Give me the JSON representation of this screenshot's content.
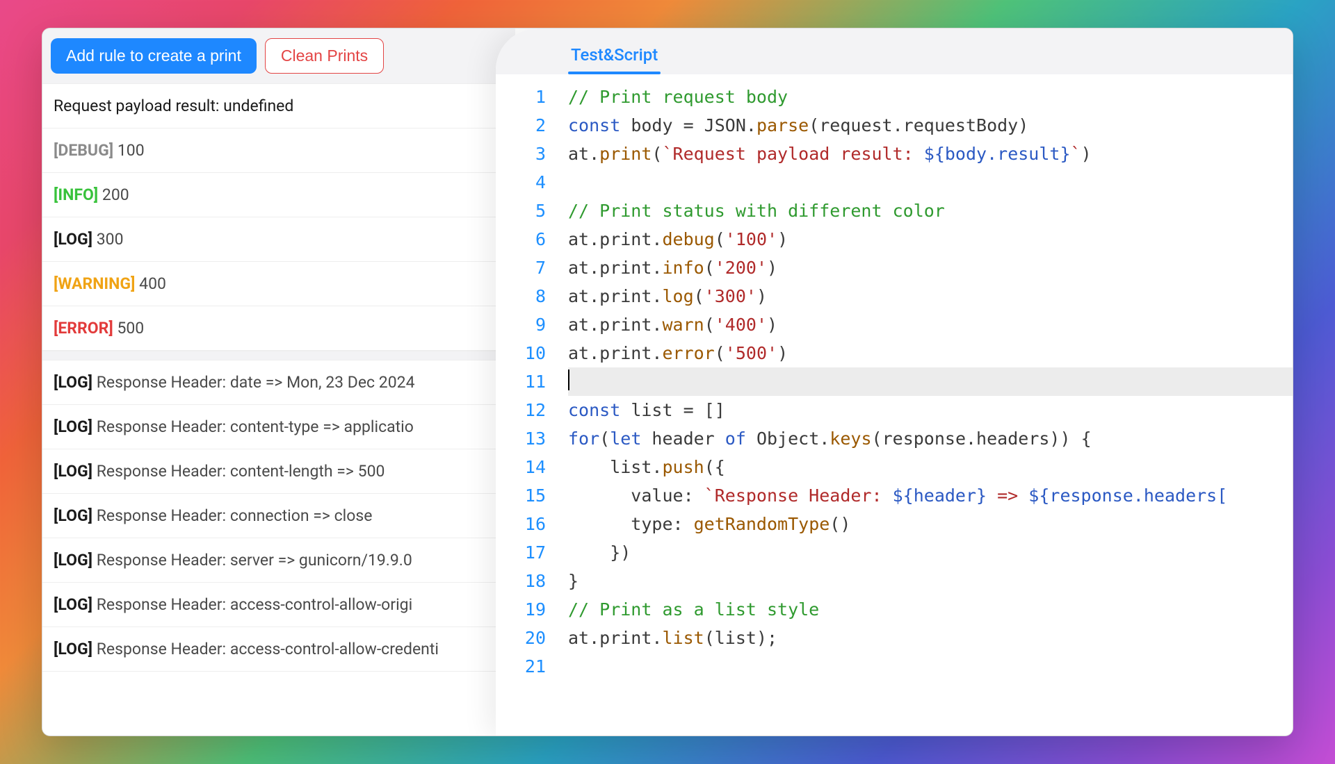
{
  "toolbar": {
    "add_rule_label": "Add rule to create a print",
    "clean_label": "Clean Prints"
  },
  "logs_top": [
    {
      "tag": null,
      "tagClass": "",
      "msg": "Request payload result: undefined"
    },
    {
      "tag": "[DEBUG]",
      "tagClass": "tag-debug",
      "msg": "100"
    },
    {
      "tag": "[INFO]",
      "tagClass": "tag-info",
      "msg": "200"
    },
    {
      "tag": "[LOG]",
      "tagClass": "tag-log",
      "msg": "300"
    },
    {
      "tag": "[WARNING]",
      "tagClass": "tag-warn",
      "msg": "400"
    },
    {
      "tag": "[ERROR]",
      "tagClass": "tag-error",
      "msg": "500"
    }
  ],
  "logs_bottom": [
    {
      "tag": "[LOG]",
      "tagClass": "tag-log",
      "msg": "Response Header: date => Mon, 23 Dec 2024"
    },
    {
      "tag": "[LOG]",
      "tagClass": "tag-log",
      "msg": "Response Header: content-type => applicatio"
    },
    {
      "tag": "[LOG]",
      "tagClass": "tag-log",
      "msg": "Response Header: content-length => 500"
    },
    {
      "tag": "[LOG]",
      "tagClass": "tag-log",
      "msg": "Response Header: connection => close"
    },
    {
      "tag": "[LOG]",
      "tagClass": "tag-log",
      "msg": "Response Header: server => gunicorn/19.9.0"
    },
    {
      "tag": "[LOG]",
      "tagClass": "tag-log",
      "msg": "Response Header: access-control-allow-origi"
    },
    {
      "tag": "[LOG]",
      "tagClass": "tag-log",
      "msg": "Response Header: access-control-allow-credenti"
    }
  ],
  "tab": {
    "label": "Test&Script"
  },
  "code": {
    "line_count": 21,
    "current_line": 11,
    "lines": [
      [
        {
          "c": "tk-comment",
          "t": "// Print request body"
        }
      ],
      [
        {
          "c": "tk-kw",
          "t": "const"
        },
        {
          "c": "",
          "t": " body = JSON."
        },
        {
          "c": "tk-fn",
          "t": "parse"
        },
        {
          "c": "",
          "t": "(request.requestBody)"
        }
      ],
      [
        {
          "c": "",
          "t": "at."
        },
        {
          "c": "tk-fn",
          "t": "print"
        },
        {
          "c": "",
          "t": "("
        },
        {
          "c": "tk-str",
          "t": "`Request payload result: "
        },
        {
          "c": "tk-embed",
          "t": "${body.result}"
        },
        {
          "c": "tk-str",
          "t": "`"
        },
        {
          "c": "",
          "t": ")"
        }
      ],
      [
        {
          "c": "",
          "t": ""
        }
      ],
      [
        {
          "c": "tk-comment",
          "t": "// Print status with different color"
        }
      ],
      [
        {
          "c": "",
          "t": "at.print."
        },
        {
          "c": "tk-fn",
          "t": "debug"
        },
        {
          "c": "",
          "t": "("
        },
        {
          "c": "tk-str",
          "t": "'100'"
        },
        {
          "c": "",
          "t": ")"
        }
      ],
      [
        {
          "c": "",
          "t": "at.print."
        },
        {
          "c": "tk-fn",
          "t": "info"
        },
        {
          "c": "",
          "t": "("
        },
        {
          "c": "tk-str",
          "t": "'200'"
        },
        {
          "c": "",
          "t": ")"
        }
      ],
      [
        {
          "c": "",
          "t": "at.print."
        },
        {
          "c": "tk-fn",
          "t": "log"
        },
        {
          "c": "",
          "t": "("
        },
        {
          "c": "tk-str",
          "t": "'300'"
        },
        {
          "c": "",
          "t": ")"
        }
      ],
      [
        {
          "c": "",
          "t": "at.print."
        },
        {
          "c": "tk-fn",
          "t": "warn"
        },
        {
          "c": "",
          "t": "("
        },
        {
          "c": "tk-str",
          "t": "'400'"
        },
        {
          "c": "",
          "t": ")"
        }
      ],
      [
        {
          "c": "",
          "t": "at.print."
        },
        {
          "c": "tk-fn",
          "t": "error"
        },
        {
          "c": "",
          "t": "("
        },
        {
          "c": "tk-str",
          "t": "'500'"
        },
        {
          "c": "",
          "t": ")"
        }
      ],
      [
        {
          "c": "",
          "t": ""
        }
      ],
      [
        {
          "c": "tk-kw",
          "t": "const"
        },
        {
          "c": "",
          "t": " list = []"
        }
      ],
      [
        {
          "c": "tk-kw",
          "t": "for"
        },
        {
          "c": "",
          "t": "("
        },
        {
          "c": "tk-kw",
          "t": "let"
        },
        {
          "c": "",
          "t": " header "
        },
        {
          "c": "tk-kw",
          "t": "of"
        },
        {
          "c": "",
          "t": " Object."
        },
        {
          "c": "tk-fn",
          "t": "keys"
        },
        {
          "c": "",
          "t": "(response.headers)) {"
        }
      ],
      [
        {
          "c": "",
          "t": "    list."
        },
        {
          "c": "tk-fn",
          "t": "push"
        },
        {
          "c": "",
          "t": "({"
        }
      ],
      [
        {
          "c": "",
          "t": "      value: "
        },
        {
          "c": "tk-str",
          "t": "`Response Header: "
        },
        {
          "c": "tk-embed",
          "t": "${header}"
        },
        {
          "c": "tk-str",
          "t": " => "
        },
        {
          "c": "tk-embed",
          "t": "${response.headers["
        }
      ],
      [
        {
          "c": "",
          "t": "      type: "
        },
        {
          "c": "tk-fn",
          "t": "getRandomType"
        },
        {
          "c": "",
          "t": "()"
        }
      ],
      [
        {
          "c": "",
          "t": "    })"
        }
      ],
      [
        {
          "c": "",
          "t": "}"
        }
      ],
      [
        {
          "c": "tk-comment",
          "t": "// Print as a list style"
        }
      ],
      [
        {
          "c": "",
          "t": "at.print."
        },
        {
          "c": "tk-fn",
          "t": "list"
        },
        {
          "c": "",
          "t": "(list);"
        }
      ],
      [
        {
          "c": "",
          "t": ""
        }
      ]
    ]
  }
}
